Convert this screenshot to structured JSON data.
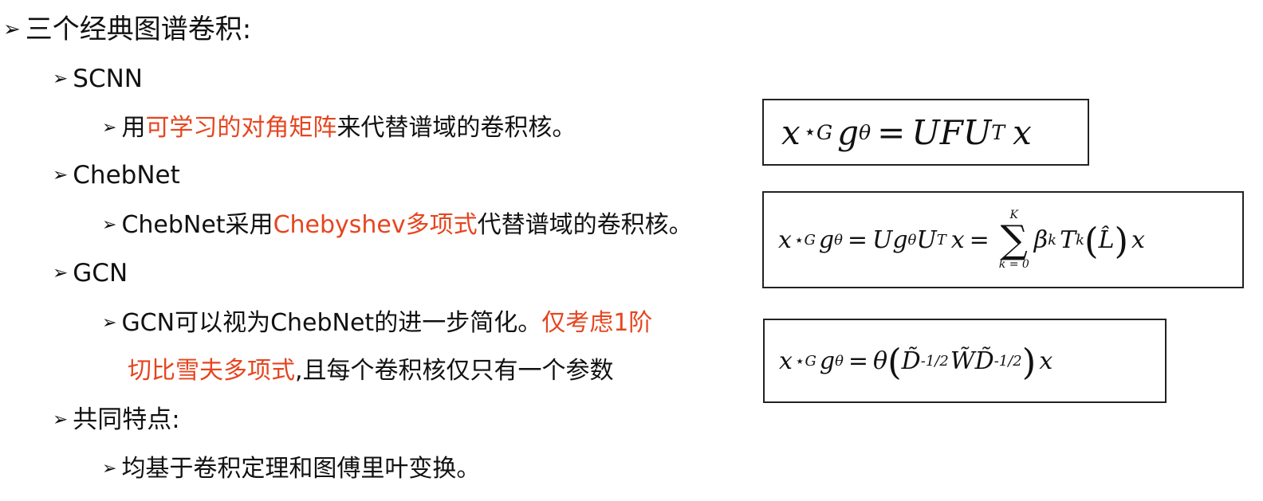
{
  "heading": "三个经典图谱卷积:",
  "arrow": "➢",
  "items": {
    "scnn": {
      "title": "SCNN",
      "desc": {
        "pre": "用",
        "hl": "可学习的对角矩阵",
        "post": "来代替谱域的卷积核。"
      }
    },
    "chebnet": {
      "title": "ChebNet",
      "desc": {
        "pre": "ChebNet采用",
        "hl": "Chebyshev多项式",
        "post": "代替谱域的卷积核。"
      }
    },
    "gcn": {
      "title": "GCN",
      "desc": {
        "line1_pre": "GCN可以视为ChebNet的进一步简化。",
        "line1_hl": "仅考虑1阶",
        "line2_hl": "切比雪夫多项式",
        "line2_post": ",且每个卷积核仅只有一个参数"
      }
    },
    "common": {
      "title": "共同特点:",
      "desc": "均基于卷积定理和图傅里叶变换。"
    }
  },
  "colors": {
    "highlight": "#e6451f",
    "text": "#111111",
    "border": "#222222"
  },
  "formulas": {
    "scnn": {
      "lhs_x": "x",
      "star": "⋆",
      "sub_G": "G",
      "g": "g",
      "theta": "θ",
      "eq": "=",
      "rhs": "UFU",
      "sup_T": "T",
      "rhs_x": "x"
    },
    "chebnet": {
      "lhs": "x",
      "star": "⋆",
      "sub_G": "G",
      "g": "g",
      "theta": "θ",
      "eq1": "=",
      "mid": "Ug",
      "mid_theta": "θ",
      "U": "U",
      "sup_T": "T",
      "mid_x": "x",
      "eq2": "=",
      "sum_upper": "K",
      "sum_lower": "k = 0",
      "beta": "β",
      "sub_k": "k",
      "T": "T",
      "sub_k2": "k",
      "L": "L̂",
      "tail_x": "x"
    },
    "gcn": {
      "lhs": "x",
      "star": "⋆",
      "sub_G": "G",
      "g": "g",
      "theta": "θ",
      "eq": "=",
      "theta2": "θ",
      "D": "D̃",
      "exp1": "-1/2",
      "W": "W̃",
      "D2": "D̃",
      "exp2": "-1/2",
      "tail_x": "x"
    }
  }
}
